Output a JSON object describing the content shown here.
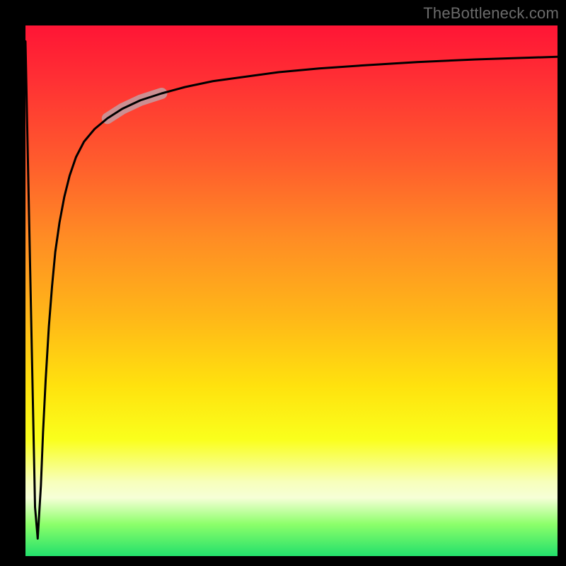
{
  "watermark": "TheBottleneck.com",
  "chart_data": {
    "type": "line",
    "title": "",
    "xlabel": "",
    "ylabel": "",
    "xlim": [
      0,
      100
    ],
    "ylim": [
      0,
      100
    ],
    "grid": false,
    "legend": "none",
    "annotations": [],
    "series": [
      {
        "name": "curve",
        "x": [
          0.0,
          1.8,
          2.3,
          2.9,
          3.3,
          3.8,
          4.4,
          5.0,
          5.6,
          6.4,
          7.3,
          8.3,
          9.5,
          11.0,
          13.0,
          15.4,
          18.2,
          21.6,
          25.6,
          30.0,
          35.2,
          41.0,
          47.6,
          55.2,
          63.8,
          73.6,
          84.6,
          100.0
        ],
        "y": [
          97.0,
          9.2,
          3.3,
          13.3,
          23.3,
          33.3,
          43.3,
          50.9,
          57.3,
          62.9,
          67.7,
          71.7,
          75.2,
          78.1,
          80.5,
          82.5,
          84.3,
          85.9,
          87.2,
          88.4,
          89.5,
          90.3,
          91.2,
          91.9,
          92.5,
          93.1,
          93.6,
          94.1
        ]
      },
      {
        "name": "highlight-segment",
        "x": [
          15.4,
          18.2,
          21.6,
          25.6
        ],
        "y": [
          82.5,
          84.3,
          85.9,
          87.2
        ],
        "style": "thick-pale"
      }
    ]
  }
}
